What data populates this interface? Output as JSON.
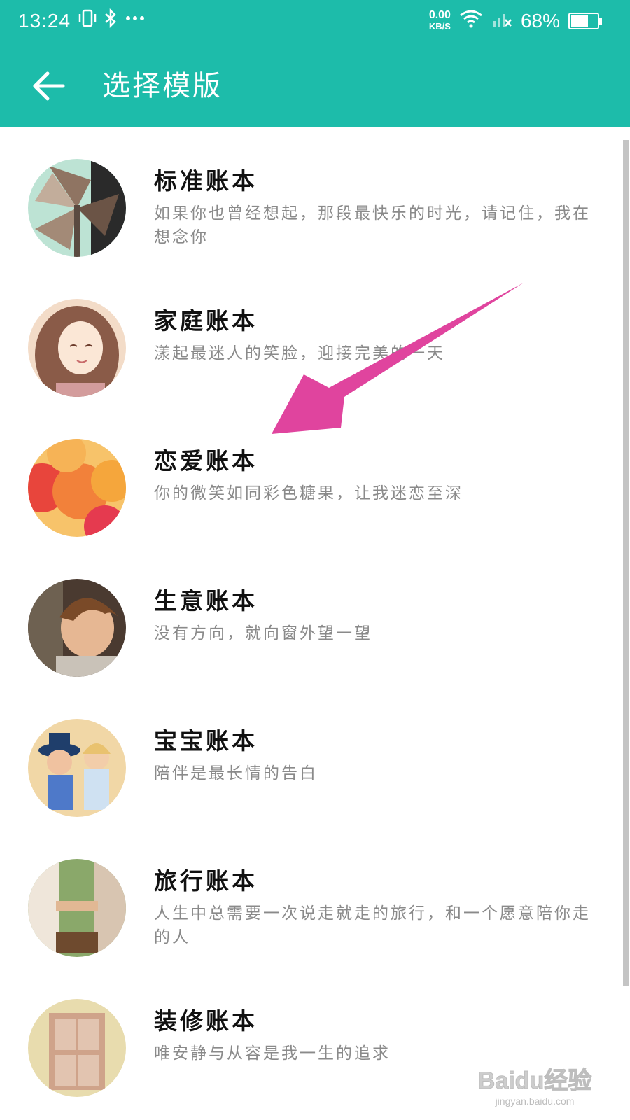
{
  "status_bar": {
    "time": "13:24",
    "left_icons": [
      "vibrate-icon",
      "bluetooth-icon",
      "more-dots-icon"
    ],
    "net_speed": "0.00",
    "net_unit": "KB/S",
    "battery": "68%",
    "battery_level": 0.68
  },
  "appbar": {
    "title": "选择模版",
    "accent_color": "#1dbcaa"
  },
  "templates": [
    {
      "title": "标准账本",
      "desc": "如果你也曾经想起，那段最快乐的时光，请记住，我在想念你"
    },
    {
      "title": "家庭账本",
      "desc": "漾起最迷人的笑脸，迎接完美的一天"
    },
    {
      "title": "恋爱账本",
      "desc": "你的微笑如同彩色糖果，让我迷恋至深"
    },
    {
      "title": "生意账本",
      "desc": "没有方向，就向窗外望一望"
    },
    {
      "title": "宝宝账本",
      "desc": "陪伴是最长情的告白"
    },
    {
      "title": "旅行账本",
      "desc": "人生中总需要一次说走就走的旅行，和一个愿意陪你走的人"
    },
    {
      "title": "装修账本",
      "desc": "唯安静与从容是我一生的追求"
    }
  ],
  "annotation": {
    "arrow_color": "#e0449e"
  },
  "watermark": {
    "logo": "Baidu经验",
    "url": "jingyan.baidu.com"
  }
}
